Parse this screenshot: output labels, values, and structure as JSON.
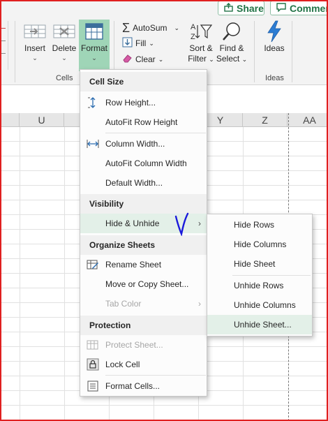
{
  "topbar": {
    "share_label": "Share",
    "comments_label": "Comments"
  },
  "ribbon": {
    "cells_group": {
      "insert_label": "Insert",
      "delete_label": "Delete",
      "format_label": "Format",
      "group_label": "Cells"
    },
    "editing_group": {
      "autosum_label": "AutoSum",
      "fill_label": "Fill",
      "clear_label": "Clear",
      "sort_filter_line1": "Sort &",
      "sort_filter_line2": "Filter",
      "find_select_line1": "Find &",
      "find_select_line2": "Select"
    },
    "ideas_group": {
      "ideas_label": "Ideas",
      "group_label": "Ideas"
    }
  },
  "grid": {
    "columns": [
      "U",
      "Y",
      "Z",
      "AA"
    ]
  },
  "format_menu": {
    "cell_size_header": "Cell Size",
    "row_height": "Row Height...",
    "autofit_row_height": "AutoFit Row Height",
    "column_width": "Column Width...",
    "autofit_column_width": "AutoFit Column Width",
    "default_width": "Default Width...",
    "visibility_header": "Visibility",
    "hide_unhide": "Hide & Unhide",
    "organize_header": "Organize Sheets",
    "rename_sheet": "Rename Sheet",
    "move_copy_sheet": "Move or Copy Sheet...",
    "tab_color": "Tab Color",
    "protection_header": "Protection",
    "protect_sheet": "Protect Sheet...",
    "lock_cell": "Lock Cell",
    "format_cells": "Format Cells..."
  },
  "hide_unhide_submenu": {
    "hide_rows": "Hide Rows",
    "hide_columns": "Hide Columns",
    "hide_sheet": "Hide Sheet",
    "unhide_rows": "Unhide Rows",
    "unhide_columns": "Unhide Columns",
    "unhide_sheet": "Unhide Sheet..."
  },
  "colors": {
    "accent": "#217346",
    "format_selected_bg": "#9fd5b7",
    "hover_bg": "#e3f0e8",
    "annotation_ink": "#1a1adb"
  }
}
